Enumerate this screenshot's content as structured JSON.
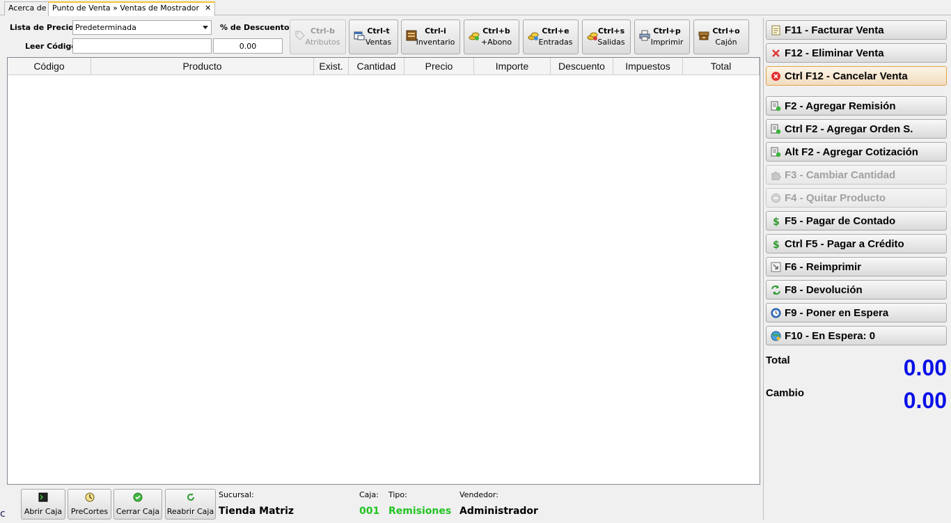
{
  "tabs": [
    {
      "label": "Acerca de"
    },
    {
      "label": "Punto de Venta » Ventas de Mostrador",
      "close": "✕"
    }
  ],
  "form": {
    "lista_label": "Lista de Precios",
    "lista_value": "Predeterminada",
    "descuento_label": "% de Descuento",
    "descuento_value": "0.00",
    "leer_label": "Leer Código",
    "leer_value": ""
  },
  "toolbar": [
    {
      "key": "Ctrl-b",
      "label": "Atributos",
      "icon": "tag-icon",
      "enabled": false
    },
    {
      "key": "Ctrl-t",
      "label": "Ventas",
      "icon": "ventas-icon",
      "enabled": true
    },
    {
      "key": "Ctrl-i",
      "label": "Inventario",
      "icon": "inventory-icon",
      "enabled": true
    },
    {
      "key": "Ctrl+b",
      "label": "+Abono",
      "icon": "coins-icon",
      "enabled": true
    },
    {
      "key": "Ctrl+e",
      "label": "Entradas",
      "icon": "coins-in-icon",
      "enabled": true
    },
    {
      "key": "Ctrl+s",
      "label": "Salidas",
      "icon": "coins-out-icon",
      "enabled": true
    },
    {
      "key": "Ctrl+p",
      "label": "Imprimir",
      "icon": "printer-icon",
      "enabled": true
    },
    {
      "key": "Ctrl+o",
      "label": "Cajón",
      "icon": "drawer-icon",
      "enabled": true
    }
  ],
  "grid": {
    "columns": [
      "Código",
      "Producto",
      "Exist.",
      "Cantidad",
      "Precio",
      "Importe",
      "Descuento",
      "Impuestos",
      "Total"
    ],
    "rows": []
  },
  "bottom": {
    "buttons": [
      {
        "label": "Abrir Caja",
        "icon": "terminal-icon"
      },
      {
        "label": "PreCortes",
        "icon": "clock-icon"
      },
      {
        "label": "Cerrar Caja",
        "icon": "check-icon"
      },
      {
        "label": "Reabrir Caja",
        "icon": "refresh-icon"
      }
    ],
    "sucursal_label": "Sucursal:",
    "sucursal_value": "Tienda Matriz",
    "caja_label": "Caja:",
    "caja_value": "001",
    "tipo_label": "Tipo:",
    "tipo_value": "Remisiones",
    "vendedor_label": "Vendedor:",
    "vendedor_value": "Administrador"
  },
  "actions": [
    {
      "label": "F11 - Facturar Venta",
      "icon": "invoice-icon",
      "enabled": true
    },
    {
      "label": "F12 - Eliminar Venta",
      "icon": "delete-x-icon",
      "enabled": true
    },
    {
      "label": "Ctrl F12 - Cancelar Venta",
      "icon": "cancel-circle-icon",
      "enabled": true,
      "highlight": true
    },
    {
      "label": "F2 - Agregar Remisión",
      "icon": "add-doc-icon",
      "enabled": true
    },
    {
      "label": "Ctrl F2 - Agregar Orden S.",
      "icon": "add-doc-icon",
      "enabled": true
    },
    {
      "label": "Alt F2 - Agregar Cotización",
      "icon": "add-doc-icon",
      "enabled": true
    },
    {
      "label": "F3 - Cambiar Cantidad",
      "icon": "puzzle-icon",
      "enabled": false
    },
    {
      "label": "F4 - Quitar Producto",
      "icon": "minus-circle-icon",
      "enabled": false
    },
    {
      "label": "F5 - Pagar de Contado",
      "icon": "dollar-icon",
      "enabled": true
    },
    {
      "label": "Ctrl F5 - Pagar a Crédito",
      "icon": "dollar-icon",
      "enabled": true
    },
    {
      "label": "F6 - Reimprimir",
      "icon": "reprint-icon",
      "enabled": true
    },
    {
      "label": "F8 - Devolución",
      "icon": "return-icon",
      "enabled": true
    },
    {
      "label": "F9 - Poner en Espera",
      "icon": "wait-clock-icon",
      "enabled": true
    },
    {
      "label": "F10 - En Espera: 0",
      "icon": "globe-icon",
      "enabled": true
    }
  ],
  "totals": {
    "total_label": "Total",
    "total_value": "0.00",
    "cambio_label": "Cambio",
    "cambio_value": "0.00"
  },
  "colors": {
    "accent_total": "#0a10e6",
    "green_value": "#22c322",
    "tab_accent": "#f4c430"
  }
}
